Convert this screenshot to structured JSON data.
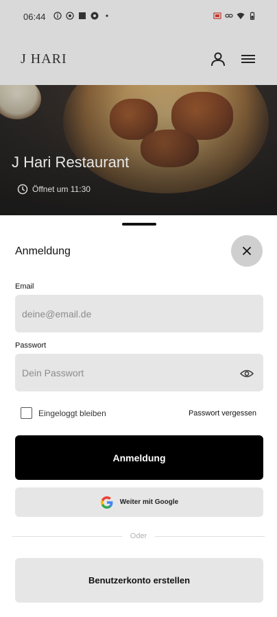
{
  "status_bar": {
    "time": "06:44",
    "left_icons": [
      "info-circle-icon",
      "app-circle-icon",
      "square-icon",
      "gear-badge-icon",
      "dot-icon"
    ],
    "right_icons": [
      "cast-icon",
      "link-icon",
      "wifi-icon",
      "battery-icon"
    ]
  },
  "header": {
    "logo": "J HARI",
    "user_icon": "user-icon",
    "menu_icon": "menu-icon"
  },
  "hero": {
    "restaurant_name": "J Hari Restaurant",
    "opening_text": "Öffnet um 11:30",
    "clock_icon": "clock-icon"
  },
  "login_sheet": {
    "title": "Anmeldung",
    "email": {
      "label": "Email",
      "placeholder": "deine@email.de",
      "value": ""
    },
    "password": {
      "label": "Passwort",
      "placeholder": "Dein Passwort",
      "value": ""
    },
    "remember_me": {
      "label": "Eingeloggt bleiben",
      "checked": false
    },
    "forgot_password": "Passwort vergessen",
    "login_button": "Anmeldung",
    "google_button": "Weiter mit Google",
    "divider_text": "Oder",
    "create_account_button": "Benutzerkonto erstellen"
  },
  "colors": {
    "header_bg": "#d9d9d9",
    "input_bg": "#e6e6e6",
    "primary_button": "#000000",
    "close_button_bg": "#cfcfcf"
  }
}
